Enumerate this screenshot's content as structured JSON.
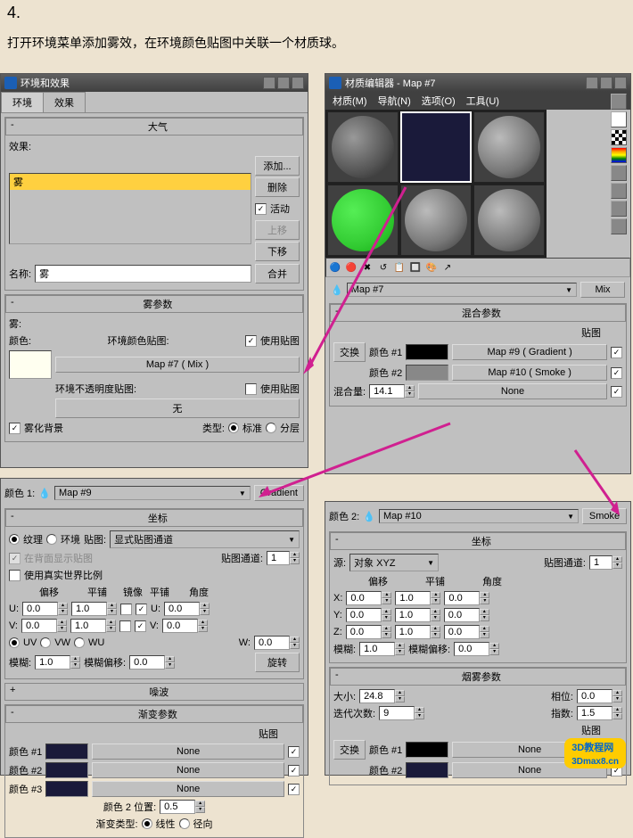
{
  "step": "4.",
  "desc": "打开环境菜单添加雾效，在环境颜色贴图中关联一个材质球。",
  "envWin": {
    "title": "环境和效果",
    "tabs": {
      "env": "环境",
      "fx": "效果"
    },
    "atmos": {
      "title": "大气",
      "fxLabel": "效果:",
      "item": "雾",
      "add": "添加...",
      "del": "删除",
      "active": "活动",
      "up": "上移",
      "down": "下移",
      "nameLabel": "名称:",
      "nameVal": "雾",
      "merge": "合并"
    },
    "fog": {
      "title": "雾参数",
      "fogLabel": "雾:",
      "color": "颜色:",
      "envMap": "环境颜色贴图:",
      "useMap": "使用贴图",
      "mapBtn": "Map #7  ( Mix )",
      "opacMap": "环境不透明度贴图:",
      "useMap2": "使用贴图",
      "none": "无",
      "fogBg": "雾化背景",
      "typeLabel": "类型:",
      "std": "标准",
      "layer": "分层"
    }
  },
  "matWin": {
    "title": "材质编辑器 - Map #7",
    "menu": {
      "mat": "材质(M)",
      "nav": "导航(N)",
      "opt": "选项(O)",
      "tool": "工具(U)"
    },
    "mapName": "Map #7",
    "mapType": "Mix",
    "mix": {
      "title": "混合参数",
      "mapCol": "贴图",
      "swap": "交换",
      "c1": "颜色 #1",
      "c2": "颜色 #2",
      "m1": "Map #9  ( Gradient )",
      "m2": "Map #10  ( Smoke )",
      "amount": "混合量:",
      "amountVal": "14.1",
      "none": "None"
    }
  },
  "gradWin": {
    "label": "颜色 1:",
    "mapName": "Map #9",
    "type": "Gradient",
    "coord": {
      "title": "坐标",
      "tex": "纹理",
      "env": "环境",
      "mapLabel": "贴图:",
      "mapVal": "显式贴图通道",
      "showBack": "在背面显示贴图",
      "chan": "贴图通道:",
      "chanVal": "1",
      "useReal": "使用真实世界比例",
      "offset": "偏移",
      "tile": "平铺",
      "mirror": "镜像",
      "tile2": "平铺",
      "angle": "角度",
      "u": "U:",
      "v": "V:",
      "w": "W:",
      "u_off": "0.0",
      "u_tile": "1.0",
      "u_ang": "0.0",
      "v_off": "0.0",
      "v_tile": "1.0",
      "v_ang": "0.0",
      "w_ang": "0.0",
      "uv": "UV",
      "vw": "VW",
      "wu": "WU",
      "blur": "模糊:",
      "blurVal": "1.0",
      "blurOff": "模糊偏移:",
      "blurOffVal": "0.0",
      "rotate": "旋转"
    },
    "noise": "噪波",
    "gparams": {
      "title": "渐变参数",
      "mapCol": "贴图",
      "c1": "颜色 #1",
      "c2": "颜色 #2",
      "c3": "颜色 #3",
      "none": "None",
      "c2pos": "颜色 2 位置:",
      "c2posVal": "0.5",
      "gtype": "渐变类型:",
      "linear": "线性",
      "radial": "径向"
    }
  },
  "smokeWin": {
    "label": "颜色 2:",
    "mapName": "Map #10",
    "type": "Smoke",
    "coord": {
      "title": "坐标",
      "src": "源:",
      "srcVal": "对象 XYZ",
      "chan": "贴图通道:",
      "chanVal": "1",
      "offset": "偏移",
      "tile": "平铺",
      "angle": "角度",
      "x": "X:",
      "y": "Y:",
      "z": "Z:",
      "xv": "0.0",
      "xt": "1.0",
      "xa": "0.0",
      "yv": "0.0",
      "yt": "1.0",
      "ya": "0.0",
      "zv": "0.0",
      "zt": "1.0",
      "za": "0.0",
      "blur": "模糊:",
      "blurVal": "1.0",
      "blurOff": "模糊偏移:",
      "blurOffVal": "0.0"
    },
    "smoke": {
      "title": "烟雾参数",
      "size": "大小:",
      "sizeVal": "24.8",
      "phase": "相位:",
      "phaseVal": "0.0",
      "iter": "迭代次数:",
      "iterVal": "9",
      "exp": "指数:",
      "expVal": "1.5",
      "mapCol": "贴图",
      "swap": "交换",
      "c1": "颜色 #1",
      "c2": "颜色 #2",
      "none": "None"
    }
  },
  "watermark": "3D教程网",
  "watermark2": "3Dmax8.cn"
}
